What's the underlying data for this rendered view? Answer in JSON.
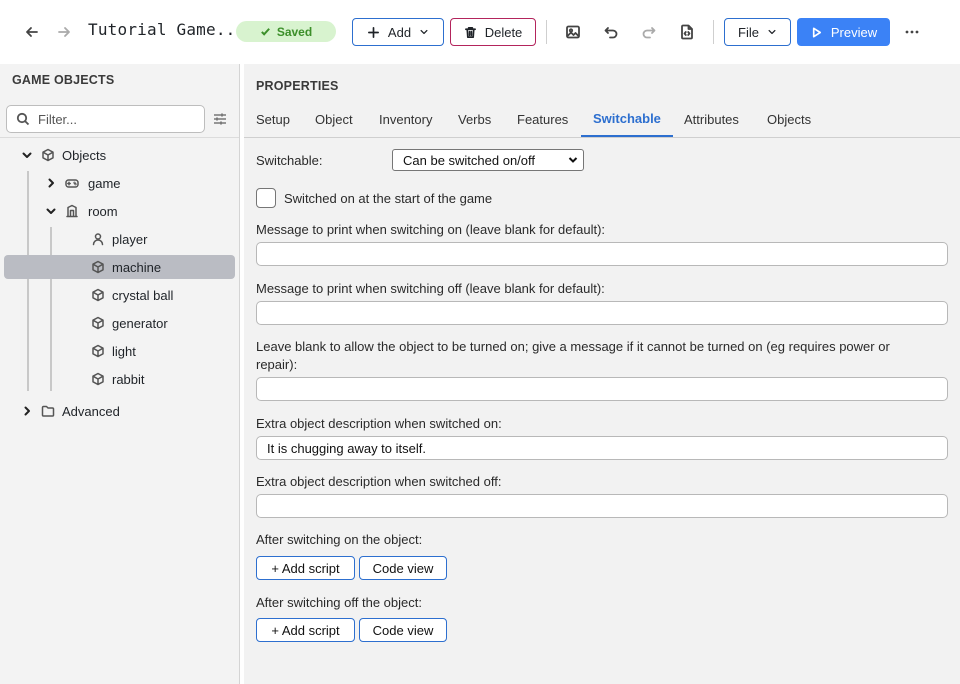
{
  "toolbar": {
    "title": "Tutorial Game...",
    "saved_label": "Saved",
    "add_label": "Add",
    "delete_label": "Delete",
    "file_label": "File",
    "preview_label": "Preview"
  },
  "left_panel": {
    "header": "GAME OBJECTS",
    "filter_placeholder": "Filter...",
    "tree": {
      "objects": "Objects",
      "game": "game",
      "room": "room",
      "player": "player",
      "machine": "machine",
      "crystal_ball": "crystal ball",
      "generator": "generator",
      "light": "light",
      "rabbit": "rabbit",
      "advanced": "Advanced"
    }
  },
  "properties": {
    "header": "PROPERTIES",
    "tabs": [
      "Setup",
      "Object",
      "Inventory",
      "Verbs",
      "Features",
      "Switchable",
      "Attributes",
      "Objects"
    ],
    "active_tab": "Switchable",
    "switchable_label": "Switchable:",
    "switchable_value": "Can be switched on/off",
    "switched_on_label": "Switched on at the start of the game",
    "msg_on_label": "Message to print when switching on (leave blank for default):",
    "msg_on_value": "",
    "msg_off_label": "Message to print when switching off (leave blank for default):",
    "msg_off_value": "",
    "blank_label_1": "Leave blank to allow the object to be turned on; give a message if it cannot be turned on (eg requires power or",
    "blank_label_2": "repair):",
    "blank_value": "",
    "extra_on_label": "Extra object description when switched on:",
    "extra_on_value": "It is chugging away to itself.",
    "extra_off_label": "Extra object description when switched off:",
    "extra_off_value": "",
    "after_on_label": "After switching on the object:",
    "after_off_label": "After switching off the object:",
    "add_script_label": "+ Add script",
    "code_view_label": "Code view"
  },
  "colors": {
    "accent": "#2d6fcf",
    "primary_button": "#3b82f6",
    "saved_bg": "#d8f3cf",
    "saved_text": "#3c8f2a",
    "delete_border": "#b3245c",
    "selected_row": "#babcc3"
  }
}
